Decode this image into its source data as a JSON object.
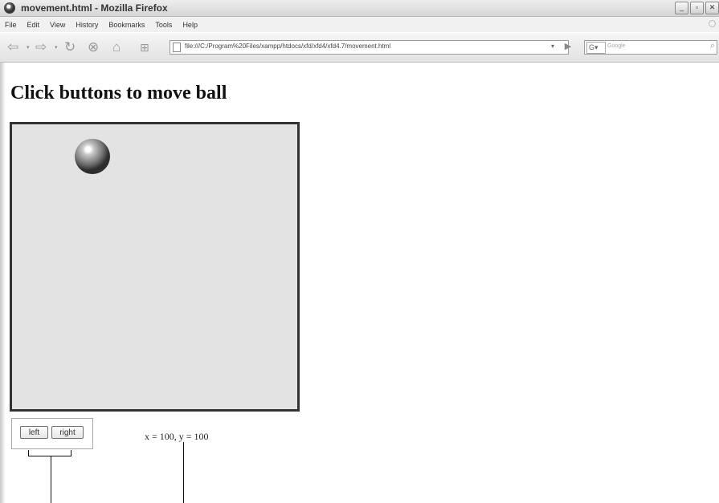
{
  "window": {
    "title": "movement.html - Mozilla Firefox",
    "controls": [
      "_",
      "▫",
      "✕"
    ]
  },
  "menubar": {
    "items": [
      "File",
      "Edit",
      "View",
      "History",
      "Bookmarks",
      "Tools",
      "Help"
    ]
  },
  "navbar": {
    "url": "file:///C:/Program%20Files/xampp/htdocs/xfd/xfd4/xfd4.7/movement.html",
    "search_placeholder": "Google",
    "search_engine_label": "G"
  },
  "page": {
    "heading": "Click buttons to move ball",
    "buttons": {
      "left_label": "left",
      "right_label": "right"
    },
    "coords_text": "x = 100, y = 100"
  },
  "colors": {
    "canvas_bg": "#e3e3e3",
    "canvas_border": "#333333",
    "ball": "#555555"
  }
}
